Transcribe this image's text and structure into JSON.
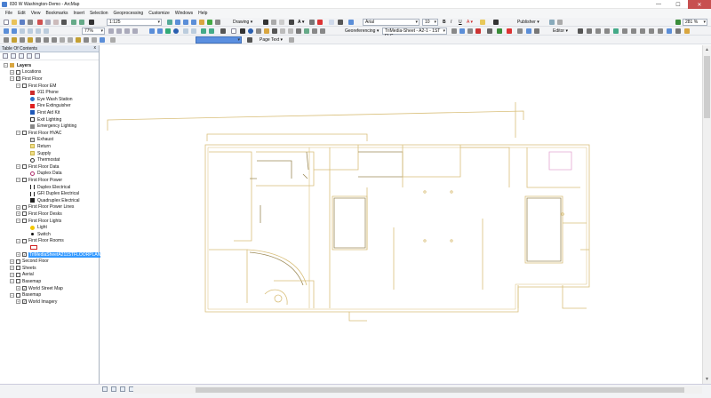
{
  "window": {
    "title": "830 W Washington-Demo - ArcMap",
    "min": "—",
    "max": "☐",
    "close": "✕"
  },
  "menu": [
    "File",
    "Edit",
    "View",
    "Bookmarks",
    "Insert",
    "Selection",
    "Geoprocessing",
    "Customize",
    "Windows",
    "Help"
  ],
  "toolbar1": {
    "scale": "1:125",
    "drawing": "Drawing ▾",
    "font": "Arial",
    "font_size": "10",
    "bold": "B",
    "italic": "I",
    "underline": "U",
    "publisher": "Publisher ▾",
    "zoom": "281 %"
  },
  "toolbar2": {
    "zoom_pct": "77%",
    "georef": "Georeferencing ▾",
    "sheet": "TriMedia-Sheet - A2-1 - 1ST FLC",
    "editor": "Editor ▾"
  },
  "toolbar3": {
    "page_text": "Page Text ▾"
  },
  "toc": {
    "title": "Table Of Contents",
    "close": "x",
    "items": [
      {
        "label": "Layers",
        "bold": true
      },
      {
        "label": "Locations"
      },
      {
        "label": "First Floor"
      },
      {
        "label": "First Floor EM"
      },
      {
        "label": "911 Phone"
      },
      {
        "label": "Eye Wash Station"
      },
      {
        "label": "Fire Extinguisher"
      },
      {
        "label": "First Aid Kit"
      },
      {
        "label": "Exit Lighting"
      },
      {
        "label": "Emergency Lighting"
      },
      {
        "label": "First Floor HVAC"
      },
      {
        "label": "Exhaust"
      },
      {
        "label": "Return"
      },
      {
        "label": "Supply"
      },
      {
        "label": "Thermostat"
      },
      {
        "label": "First Floor Data"
      },
      {
        "label": "Duplex Data"
      },
      {
        "label": "First Floor Power"
      },
      {
        "label": "Duplex Electrical"
      },
      {
        "label": "GFI Duplex Electrical"
      },
      {
        "label": "Quadruplex Electrical"
      },
      {
        "label": "First Floor Power Lines"
      },
      {
        "label": "First Floor Desks"
      },
      {
        "label": "First Floor Lights"
      },
      {
        "label": "Light"
      },
      {
        "label": "Switch"
      },
      {
        "label": "First Floor Rooms"
      },
      {
        "label": ""
      },
      {
        "label": "TriMediaSheetA211STFLOORPLAN"
      },
      {
        "label": "Second Floor"
      },
      {
        "label": "Sheets"
      },
      {
        "label": "Aerial"
      },
      {
        "label": "Basemap"
      },
      {
        "label": "World Street Map"
      },
      {
        "label": "Basemap"
      },
      {
        "label": "World Imagery"
      }
    ]
  },
  "colors": {
    "floorplan_line": "#d9bf7a",
    "floorplan_dark": "#7c6a3a",
    "pink": "#e4a6d2",
    "selection": "#3399ff"
  }
}
